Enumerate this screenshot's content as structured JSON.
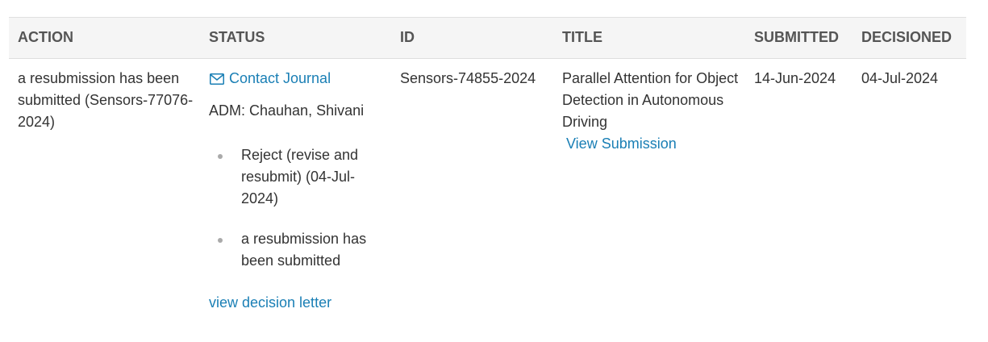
{
  "table": {
    "headers": {
      "action": "ACTION",
      "status": "STATUS",
      "id": "ID",
      "title": "TITLE",
      "submitted": "SUBMITTED",
      "decisioned": "DECISIONED"
    },
    "row": {
      "action": "a resubmission has been submitted (Sensors-77076-2024)",
      "status": {
        "contact_label": "Contact Journal",
        "adm": "ADM: Chauhan, Shivani",
        "events": [
          "Reject (revise and resubmit) (04-Jul-2024)",
          "a resubmission has been submitted"
        ],
        "decision_letter_label": "view decision letter"
      },
      "id": "Sensors-74855-2024",
      "title": "Parallel Attention for Object Detection in Autonomous Driving",
      "view_submission_label": "View Submission",
      "submitted": "14-Jun-2024",
      "decisioned": "04-Jul-2024"
    }
  },
  "colors": {
    "link": "#1a7fb5",
    "header_bg": "#f5f5f5",
    "text": "#333333"
  },
  "icons": {
    "contact": "envelope-icon"
  }
}
